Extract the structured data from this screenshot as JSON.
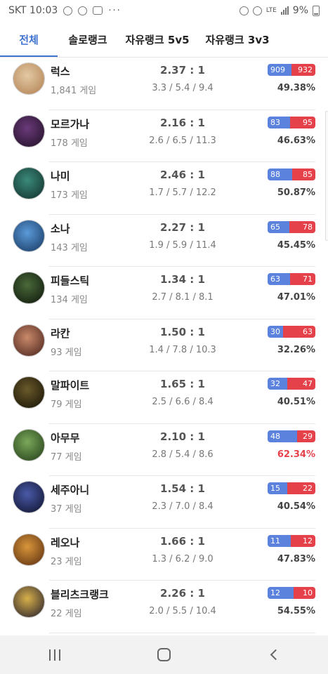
{
  "statusbar": {
    "carrier_time": "SKT 10:03",
    "dots": "···",
    "network": "LTE",
    "battery": "9%"
  },
  "tabs": [
    {
      "label": "전체",
      "active": true
    },
    {
      "label": "솔로랭크",
      "active": false
    },
    {
      "label": "자유랭크 5v5",
      "active": false
    },
    {
      "label": "자유랭크 3v3",
      "active": false
    }
  ],
  "champions": [
    {
      "name": "럭스",
      "games": "1,841 게임",
      "kda_ratio": "2.37 : 1",
      "kda": "3.3 / 5.4 / 9.4",
      "wins": "909",
      "losses": "932",
      "win_fraction": 0.4938,
      "winrate": "49.38%",
      "high": false,
      "colors": [
        "#e3c9a4",
        "#b88a5c"
      ]
    },
    {
      "name": "모르가나",
      "games": "178 게임",
      "kda_ratio": "2.16 : 1",
      "kda": "2.6 / 6.5 / 11.3",
      "wins": "83",
      "losses": "95",
      "win_fraction": 0.4663,
      "winrate": "46.63%",
      "high": false,
      "colors": [
        "#6a3a7a",
        "#2a1530"
      ]
    },
    {
      "name": "나미",
      "games": "173 게임",
      "kda_ratio": "2.46 : 1",
      "kda": "1.7 / 5.7 / 12.2",
      "wins": "88",
      "losses": "85",
      "win_fraction": 0.5087,
      "winrate": "50.87%",
      "high": false,
      "colors": [
        "#3a8a7a",
        "#173a35"
      ]
    },
    {
      "name": "소나",
      "games": "143 게임",
      "kda_ratio": "2.27 : 1",
      "kda": "1.9 / 5.9 / 11.4",
      "wins": "65",
      "losses": "78",
      "win_fraction": 0.4545,
      "winrate": "45.45%",
      "high": false,
      "colors": [
        "#5b9ad8",
        "#1f4470"
      ]
    },
    {
      "name": "피들스틱",
      "games": "134 게임",
      "kda_ratio": "1.34 : 1",
      "kda": "2.7 / 8.1 / 8.1",
      "wins": "63",
      "losses": "71",
      "win_fraction": 0.4701,
      "winrate": "47.01%",
      "high": false,
      "colors": [
        "#4a6a3a",
        "#152010"
      ]
    },
    {
      "name": "라칸",
      "games": "93 게임",
      "kda_ratio": "1.50 : 1",
      "kda": "1.4 / 7.8 / 10.3",
      "wins": "30",
      "losses": "63",
      "win_fraction": 0.3226,
      "winrate": "32.26%",
      "high": false,
      "colors": [
        "#c98a6a",
        "#5a2f25"
      ]
    },
    {
      "name": "말파이트",
      "games": "79 게임",
      "kda_ratio": "1.65 : 1",
      "kda": "2.5 / 6.6 / 8.4",
      "wins": "32",
      "losses": "47",
      "win_fraction": 0.4051,
      "winrate": "40.51%",
      "high": false,
      "colors": [
        "#6a5a2a",
        "#201a0a"
      ]
    },
    {
      "name": "아무무",
      "games": "77 게임",
      "kda_ratio": "2.10 : 1",
      "kda": "2.8 / 5.4 / 8.6",
      "wins": "48",
      "losses": "29",
      "win_fraction": 0.6234,
      "winrate": "62.34%",
      "high": true,
      "colors": [
        "#7aa85a",
        "#2e4a20"
      ]
    },
    {
      "name": "세주아니",
      "games": "37 게임",
      "kda_ratio": "1.54 : 1",
      "kda": "2.3 / 7.0 / 8.4",
      "wins": "15",
      "losses": "22",
      "win_fraction": 0.4054,
      "winrate": "40.54%",
      "high": false,
      "colors": [
        "#4a5aa8",
        "#151a3a"
      ]
    },
    {
      "name": "레오나",
      "games": "23 게임",
      "kda_ratio": "1.66 : 1",
      "kda": "1.3 / 6.2 / 9.0",
      "wins": "11",
      "losses": "12",
      "win_fraction": 0.4783,
      "winrate": "47.83%",
      "high": false,
      "colors": [
        "#d8963a",
        "#6a3a15"
      ]
    },
    {
      "name": "블리츠크랭크",
      "games": "22 게임",
      "kda_ratio": "2.26 : 1",
      "kda": "2.0 / 5.5 / 10.4",
      "wins": "12",
      "losses": "10",
      "win_fraction": 0.5455,
      "winrate": "54.55%",
      "high": false,
      "colors": [
        "#d8b04a",
        "#3a3030"
      ]
    }
  ]
}
